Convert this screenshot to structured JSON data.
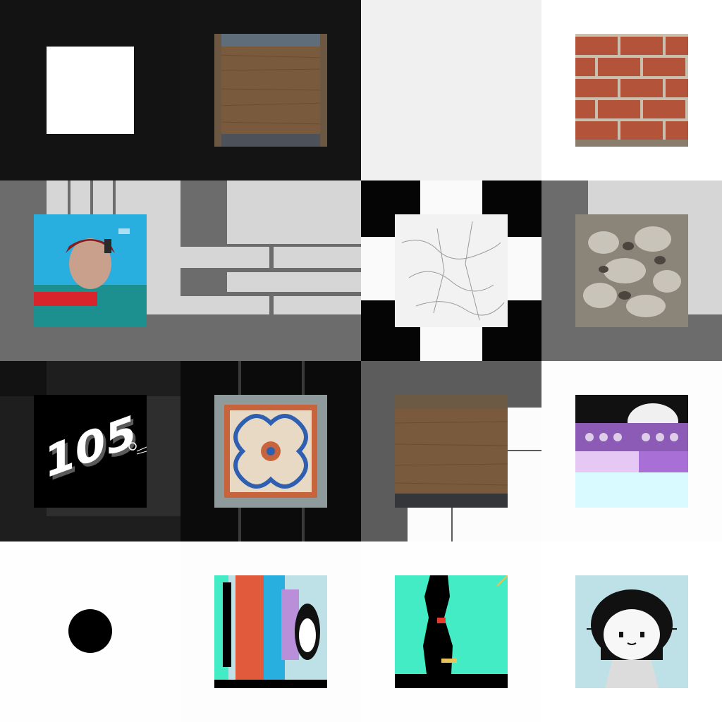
{
  "grid": {
    "rows": 4,
    "cols": 4,
    "tiles": [
      {
        "name": "white-square-tile",
        "background": "#141414"
      },
      {
        "name": "wood-plank-tile",
        "background": "#141414"
      },
      {
        "name": "blank-gray-tile",
        "background": "#f0f0f0"
      },
      {
        "name": "brick-wall-tile",
        "background": "#ffffff"
      },
      {
        "name": "glitch-portrait-tile",
        "background": "#6c6c6c"
      },
      {
        "name": "marble-texture-tile",
        "background": "#fafafa"
      },
      {
        "name": "metal-scrap-tile",
        "background": "#6c6c6c"
      },
      {
        "name": "logo-105-tile",
        "background": "#1e1e1e"
      },
      {
        "name": "mosaic-tile",
        "background": "#0b0b0b"
      },
      {
        "name": "wood-plank-2-tile",
        "background": "#5c5c5c"
      },
      {
        "name": "purple-glitch-tile",
        "background": "#fdfdfd"
      },
      {
        "name": "black-dot-tile",
        "background": "#fefefe"
      },
      {
        "name": "character-collage-tile",
        "background": "#fdfdfd"
      },
      {
        "name": "silhouette-teal-tile",
        "background": "#fefefe"
      },
      {
        "name": "cartoon-girl-tile",
        "background": "#ffffff"
      }
    ]
  },
  "logo": {
    "text": "105"
  },
  "colors": {
    "teal": "#43ecc4",
    "sky": "#29aee0",
    "brick": "#b3533a",
    "wood": "#7a5a3c",
    "pale_blue": "#bde1e6"
  }
}
